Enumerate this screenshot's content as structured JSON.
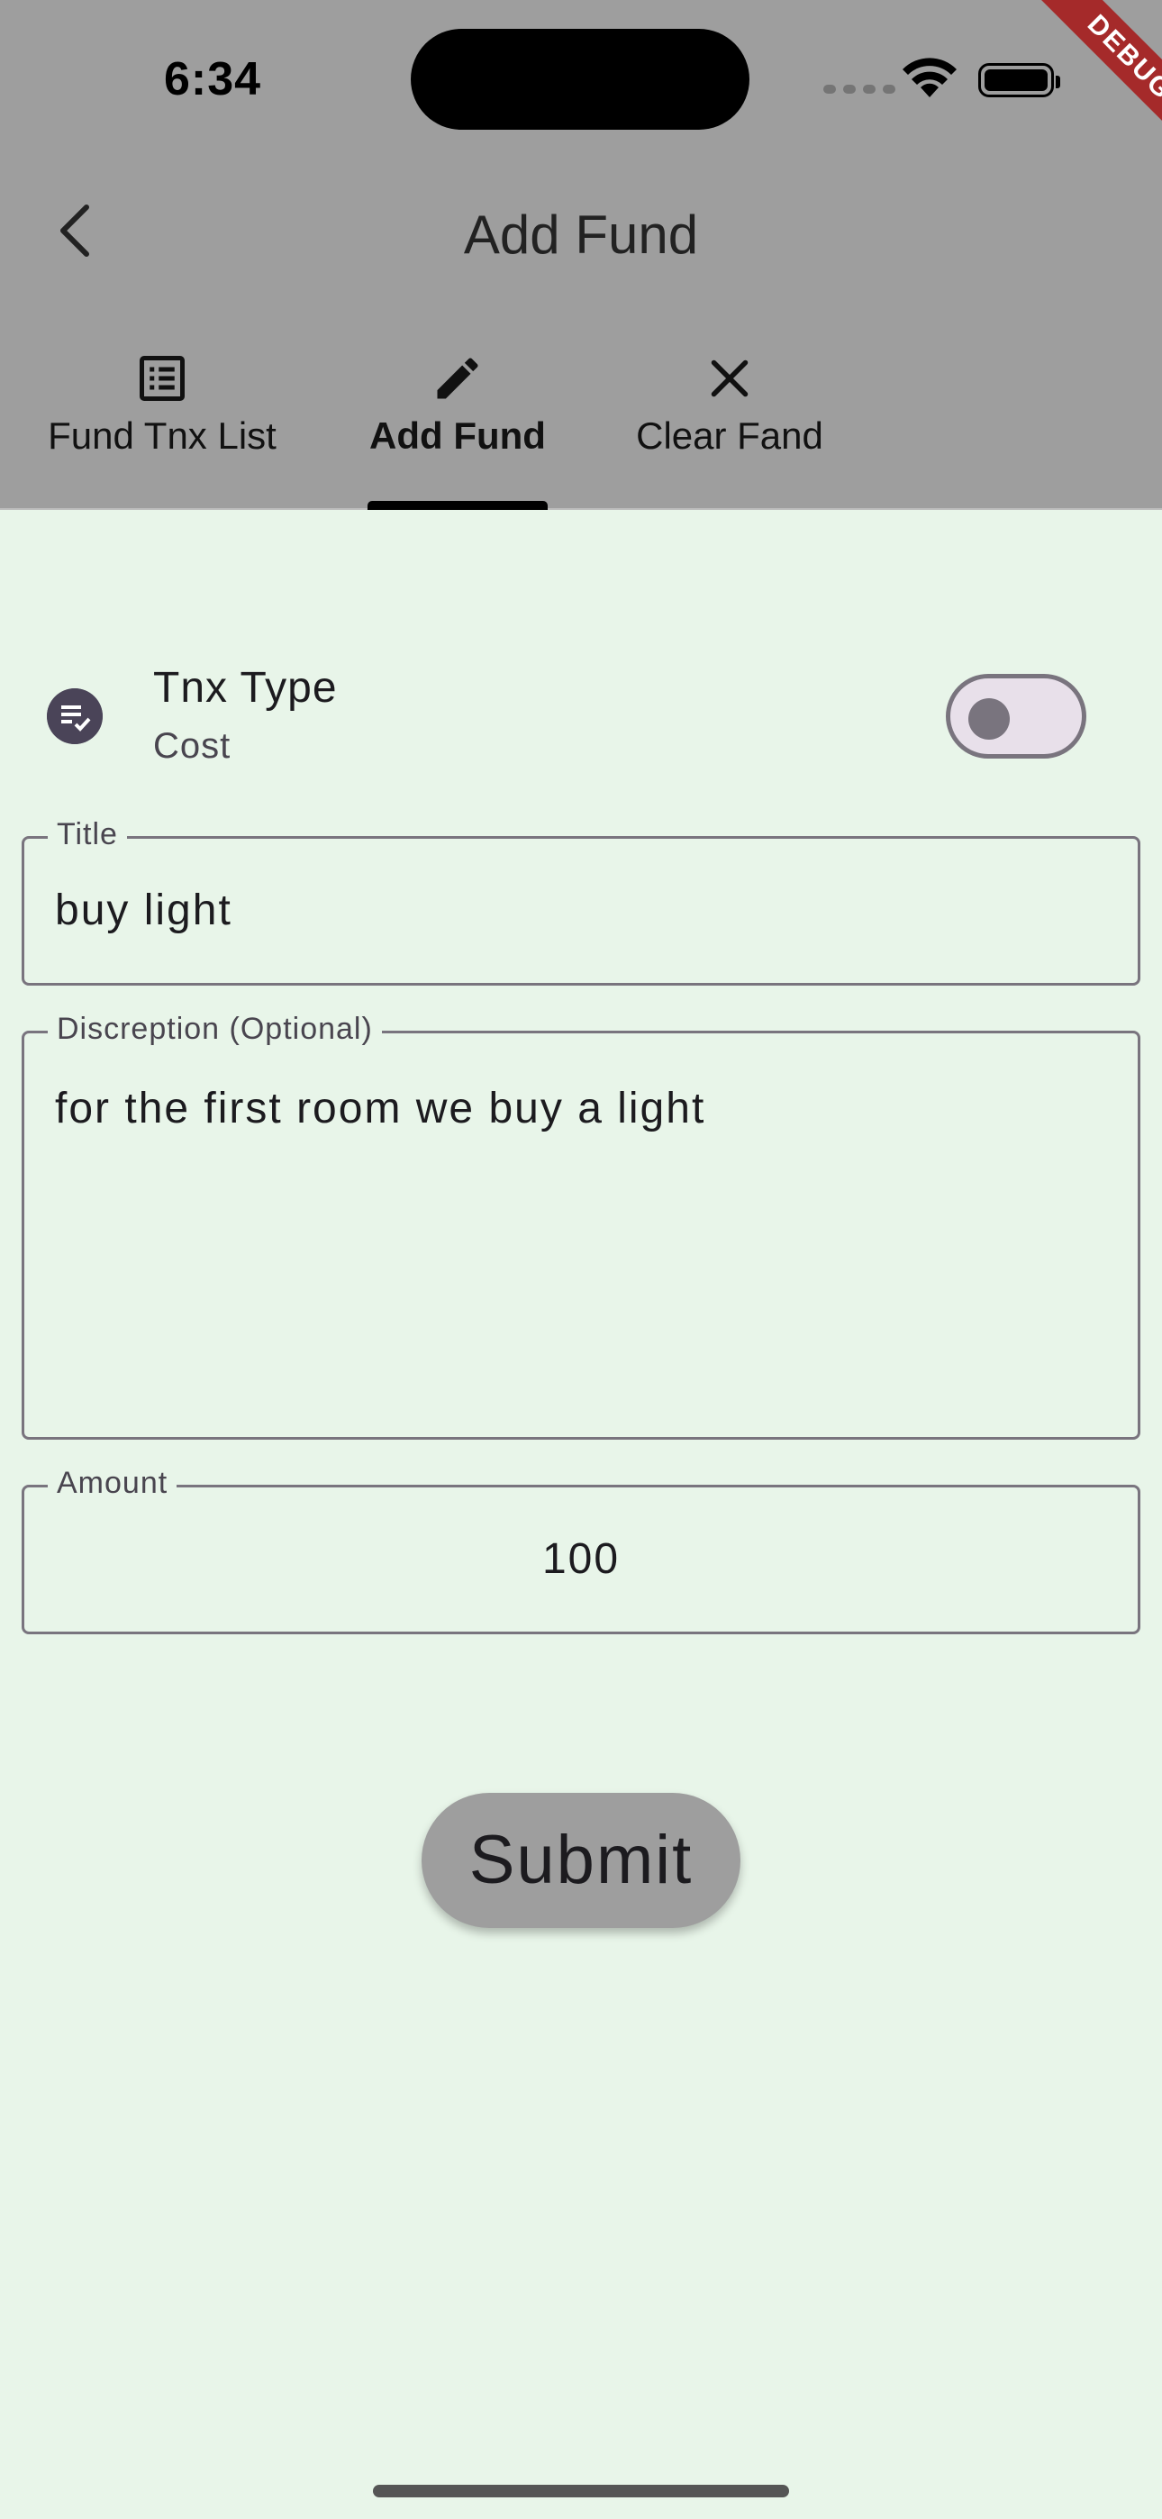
{
  "status_bar": {
    "time": "6:34",
    "debug_banner": "DEBUG"
  },
  "app_bar": {
    "title": "Add Fund",
    "back_icon": "chevron-left-icon"
  },
  "tabs": [
    {
      "label": "Fund Tnx List",
      "icon": "list-alt-icon",
      "active": false
    },
    {
      "label": "Add Fund",
      "icon": "edit-pencil-icon",
      "active": true
    },
    {
      "label": "Clear Fand",
      "icon": "close-icon",
      "active": false
    }
  ],
  "tnx_type": {
    "title": "Tnx Type",
    "subtitle": "Cost",
    "icon": "checklist-icon",
    "switch_on": false
  },
  "form": {
    "title_label": "Title",
    "title_value": "buy light",
    "description_label": "Discreption (Optional)",
    "description_value": "for the first room we buy a light",
    "amount_label": "Amount",
    "amount_value": "100"
  },
  "submit_label": "Submit",
  "colors": {
    "app_bar": "#9e9e9e",
    "background": "#e8f5e9",
    "outline": "#79747e",
    "debug_ribbon": "#a52a2a"
  }
}
